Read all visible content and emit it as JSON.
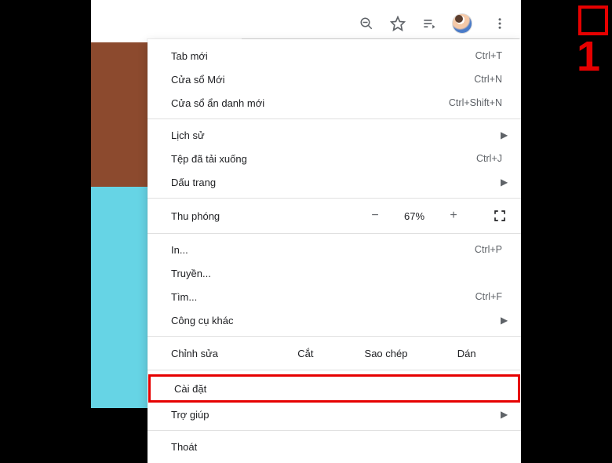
{
  "annotation": {
    "step_number": "1"
  },
  "topbar": {
    "icons": {
      "zoom_out": "zoom-out-icon",
      "star": "star-icon",
      "media": "media-control-icon",
      "avatar": "profile-avatar",
      "kebab": "more-menu-icon"
    }
  },
  "menu": {
    "new_tab": {
      "label": "Tab mới",
      "shortcut": "Ctrl+T"
    },
    "new_window": {
      "label": "Cửa sổ Mới",
      "shortcut": "Ctrl+N"
    },
    "incognito": {
      "label": "Cửa sổ ẩn danh mới",
      "shortcut": "Ctrl+Shift+N"
    },
    "history": {
      "label": "Lịch sử"
    },
    "downloads": {
      "label": "Tệp đã tải xuống",
      "shortcut": "Ctrl+J"
    },
    "bookmarks": {
      "label": "Dấu trang"
    },
    "zoom": {
      "label": "Thu phóng",
      "minus": "−",
      "value": "67%",
      "plus": "+"
    },
    "print": {
      "label": "In...",
      "shortcut": "Ctrl+P"
    },
    "cast": {
      "label": "Truyền..."
    },
    "find": {
      "label": "Tìm...",
      "shortcut": "Ctrl+F"
    },
    "more_tools": {
      "label": "Công cụ khác"
    },
    "edit": {
      "label": "Chỉnh sửa",
      "cut": "Cắt",
      "copy": "Sao chép",
      "paste": "Dán"
    },
    "settings": {
      "label": "Cài đặt"
    },
    "help": {
      "label": "Trợ giúp"
    },
    "exit": {
      "label": "Thoát"
    }
  }
}
